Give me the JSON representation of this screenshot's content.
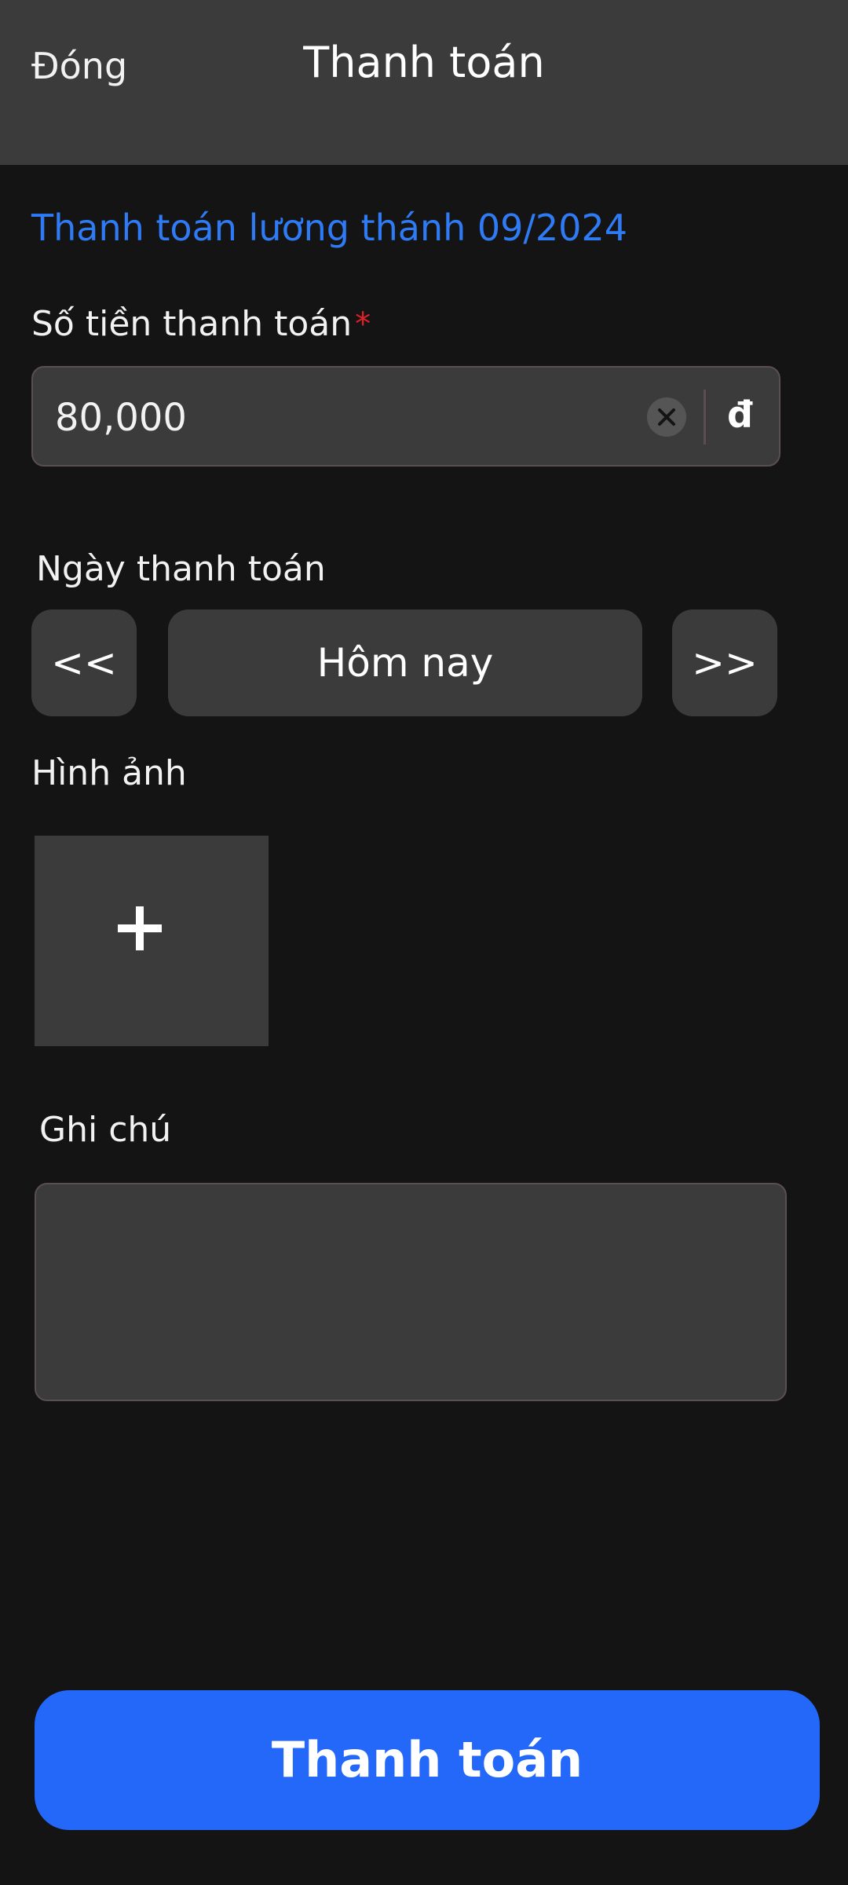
{
  "header": {
    "close_label": "Đóng",
    "title": "Thanh toán"
  },
  "subtitle": "Thanh toán lương thánh 09/2024",
  "amount": {
    "label": "Số tiền thanh toán",
    "required_marker": "*",
    "value": "80,000",
    "currency": "đ"
  },
  "date": {
    "label": "Ngày thanh toán",
    "prev_label": "<<",
    "current_label": "Hôm nay",
    "next_label": ">>"
  },
  "images": {
    "label": "Hình ảnh"
  },
  "note": {
    "label": "Ghi chú",
    "value": ""
  },
  "submit_label": "Thanh toán",
  "colors": {
    "header_bg": "#3b3b3b",
    "page_bg": "#141414",
    "accent": "#2468fa",
    "link": "#2f7bf6",
    "required": "#e0202b"
  }
}
